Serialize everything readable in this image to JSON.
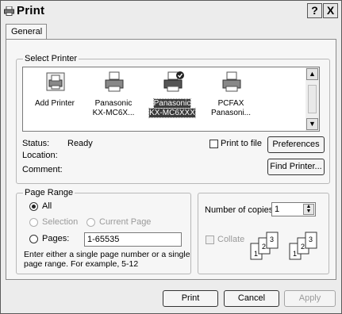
{
  "window": {
    "title": "Print",
    "help_label": "?",
    "close_label": "X"
  },
  "tabs": [
    {
      "label": "General"
    }
  ],
  "select_printer": {
    "legend": "Select Printer",
    "printers": [
      {
        "line1": "Add Printer",
        "line2": ""
      },
      {
        "line1": "Panasonic",
        "line2": "KX-MC6X..."
      },
      {
        "line1": "Panasonic",
        "line2": "KX-MC6XXX"
      },
      {
        "line1": "PCFAX",
        "line2": "Panasoni..."
      }
    ],
    "status_label": "Status:",
    "status_value": "Ready",
    "location_label": "Location:",
    "comment_label": "Comment:",
    "print_to_file_label": "Print to file",
    "preferences_label": "Preferences",
    "find_printer_label": "Find Printer..."
  },
  "page_range": {
    "legend": "Page Range",
    "all_label": "All",
    "selection_label": "Selection",
    "current_page_label": "Current Page",
    "pages_label": "Pages:",
    "pages_value": "1-65535",
    "help_text_line1": "Enter either a single page number or a single",
    "help_text_line2": "page range.  For example, 5-12"
  },
  "copies": {
    "number_label": "Number of copies:",
    "number_value": "1",
    "collate_label": "Collate",
    "collate_pages": [
      "1",
      "2",
      "3",
      "1",
      "2",
      "3"
    ]
  },
  "footer": {
    "print_label": "Print",
    "cancel_label": "Cancel",
    "apply_label": "Apply"
  }
}
